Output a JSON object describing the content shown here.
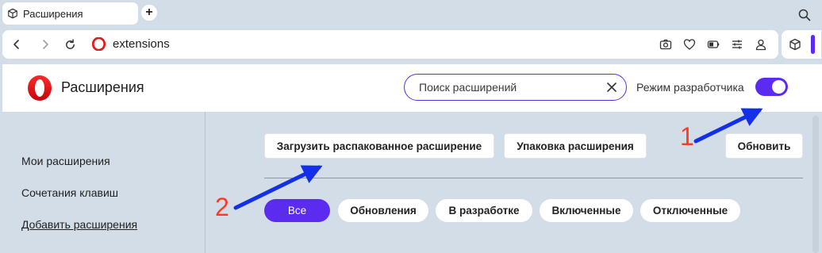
{
  "browser": {
    "tab": {
      "title": "Расширения",
      "icon": "cube-icon"
    },
    "new_tab_label": "+",
    "address_bar": {
      "url": "extensions"
    },
    "colors": {
      "accent": "#5b2bf0",
      "background": "#d3dde7",
      "opera_red": "#e11a1a"
    }
  },
  "page": {
    "title": "Расширения",
    "search": {
      "placeholder": "Поиск расширений"
    },
    "developer_mode": {
      "label": "Режим разработчика",
      "enabled": true
    }
  },
  "sidebar": {
    "items": [
      {
        "label": "Мои расширения"
      },
      {
        "label": "Сочетания клавиш"
      },
      {
        "label": "Добавить расширения"
      }
    ]
  },
  "toolbar": {
    "load_unpacked": "Загрузить распакованное расширение",
    "pack": "Упаковка расширения",
    "update": "Обновить"
  },
  "filters": {
    "items": [
      {
        "label": "Все",
        "active": true
      },
      {
        "label": "Обновления",
        "active": false
      },
      {
        "label": "В разработке",
        "active": false
      },
      {
        "label": "Включенные",
        "active": false
      },
      {
        "label": "Отключенные",
        "active": false
      }
    ]
  },
  "annotations": {
    "marker_1": "1",
    "marker_2": "2"
  }
}
